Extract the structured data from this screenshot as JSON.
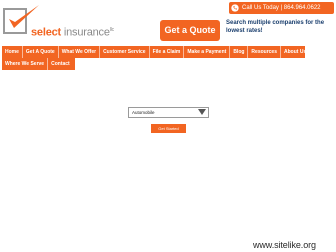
{
  "brand": {
    "name_part1": "select",
    "name_part2": "insurance",
    "trademark": "llc"
  },
  "topbar": {
    "call_label": "Call Us  Today  |  864.964.0622",
    "icon": "phone-icon"
  },
  "header": {
    "quote_button": "Get a Quote",
    "quote_text": "Search multiple companies for the lowest rates!"
  },
  "nav": {
    "row1": [
      "Home",
      "Get A Quote",
      "What We Offer",
      "Customer Service",
      "File a Claim",
      "Make a Payment",
      "Blog",
      "Resources",
      "About Us"
    ],
    "row2": [
      "Where We Serve",
      "Contact"
    ]
  },
  "form": {
    "selected_option": "Automobile",
    "submit_label": "Get Started"
  },
  "watermark": "www.sitelike.org",
  "colors": {
    "accent": "#f26522",
    "navy": "#1b3f6e",
    "gray": "#8a8a8a"
  }
}
